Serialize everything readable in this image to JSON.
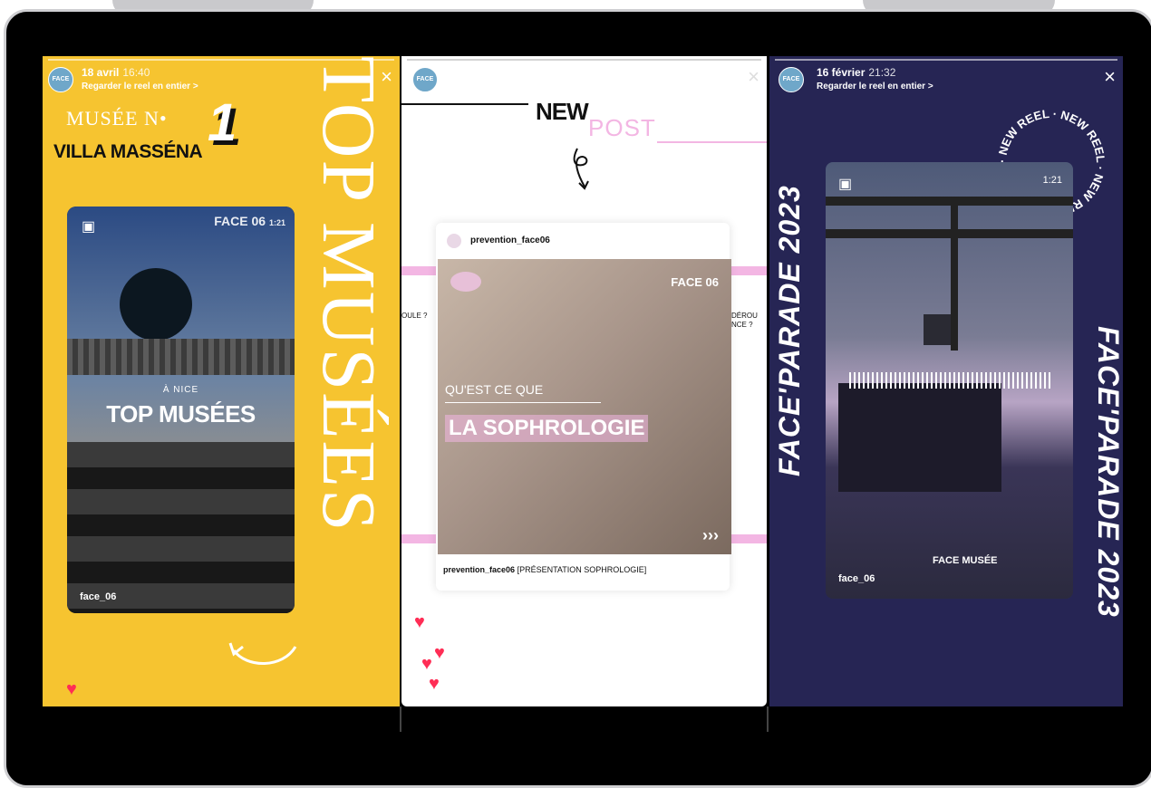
{
  "stories": [
    {
      "date": "18 avril",
      "time": "16:40",
      "reel_link": "Regarder le reel en entier >",
      "close": "×",
      "headline_1": "MUSÉE N•",
      "headline_number": "1",
      "headline_2": "VILLA MASSÉNA",
      "vertical_text": "TOP MUSÉES",
      "reel": {
        "logo": "FACE 06",
        "timer": "1:21",
        "subtitle": "À NICE",
        "title": "TOP MUSÉES",
        "user": "face_06"
      }
    },
    {
      "new_label": "NEW",
      "post_label": "POST",
      "close": "×",
      "post": {
        "account": "prevention_face06",
        "logo": "FACE 06",
        "question": "QU'EST CE QUE",
        "title": "LA SOPHROLOGIE",
        "chevrons": "›››",
        "caption_user": "prevention_face06",
        "caption_text": "[PRÉSENTATION SOPHROLOGIE]",
        "side_left": "OULE ?",
        "side_right": "DÉROU NCE ?"
      }
    },
    {
      "date": "16 février",
      "time": "21:32",
      "reel_link": "Regarder le reel en entier >",
      "close": "×",
      "vertical_left": "FACE'PARADE 2023",
      "vertical_right": "FACE'PARADE 2023",
      "circle_text": "· NEW REEL · NEW REEL · NEW REEL",
      "reel": {
        "timer": "1:21",
        "logo": "FACE MUSÉE",
        "user": "face_06"
      }
    }
  ],
  "colors": {
    "yellow": "#f6c430",
    "navy": "#262554",
    "pink": "#f3b6e3",
    "heart": "#ff2d55"
  }
}
